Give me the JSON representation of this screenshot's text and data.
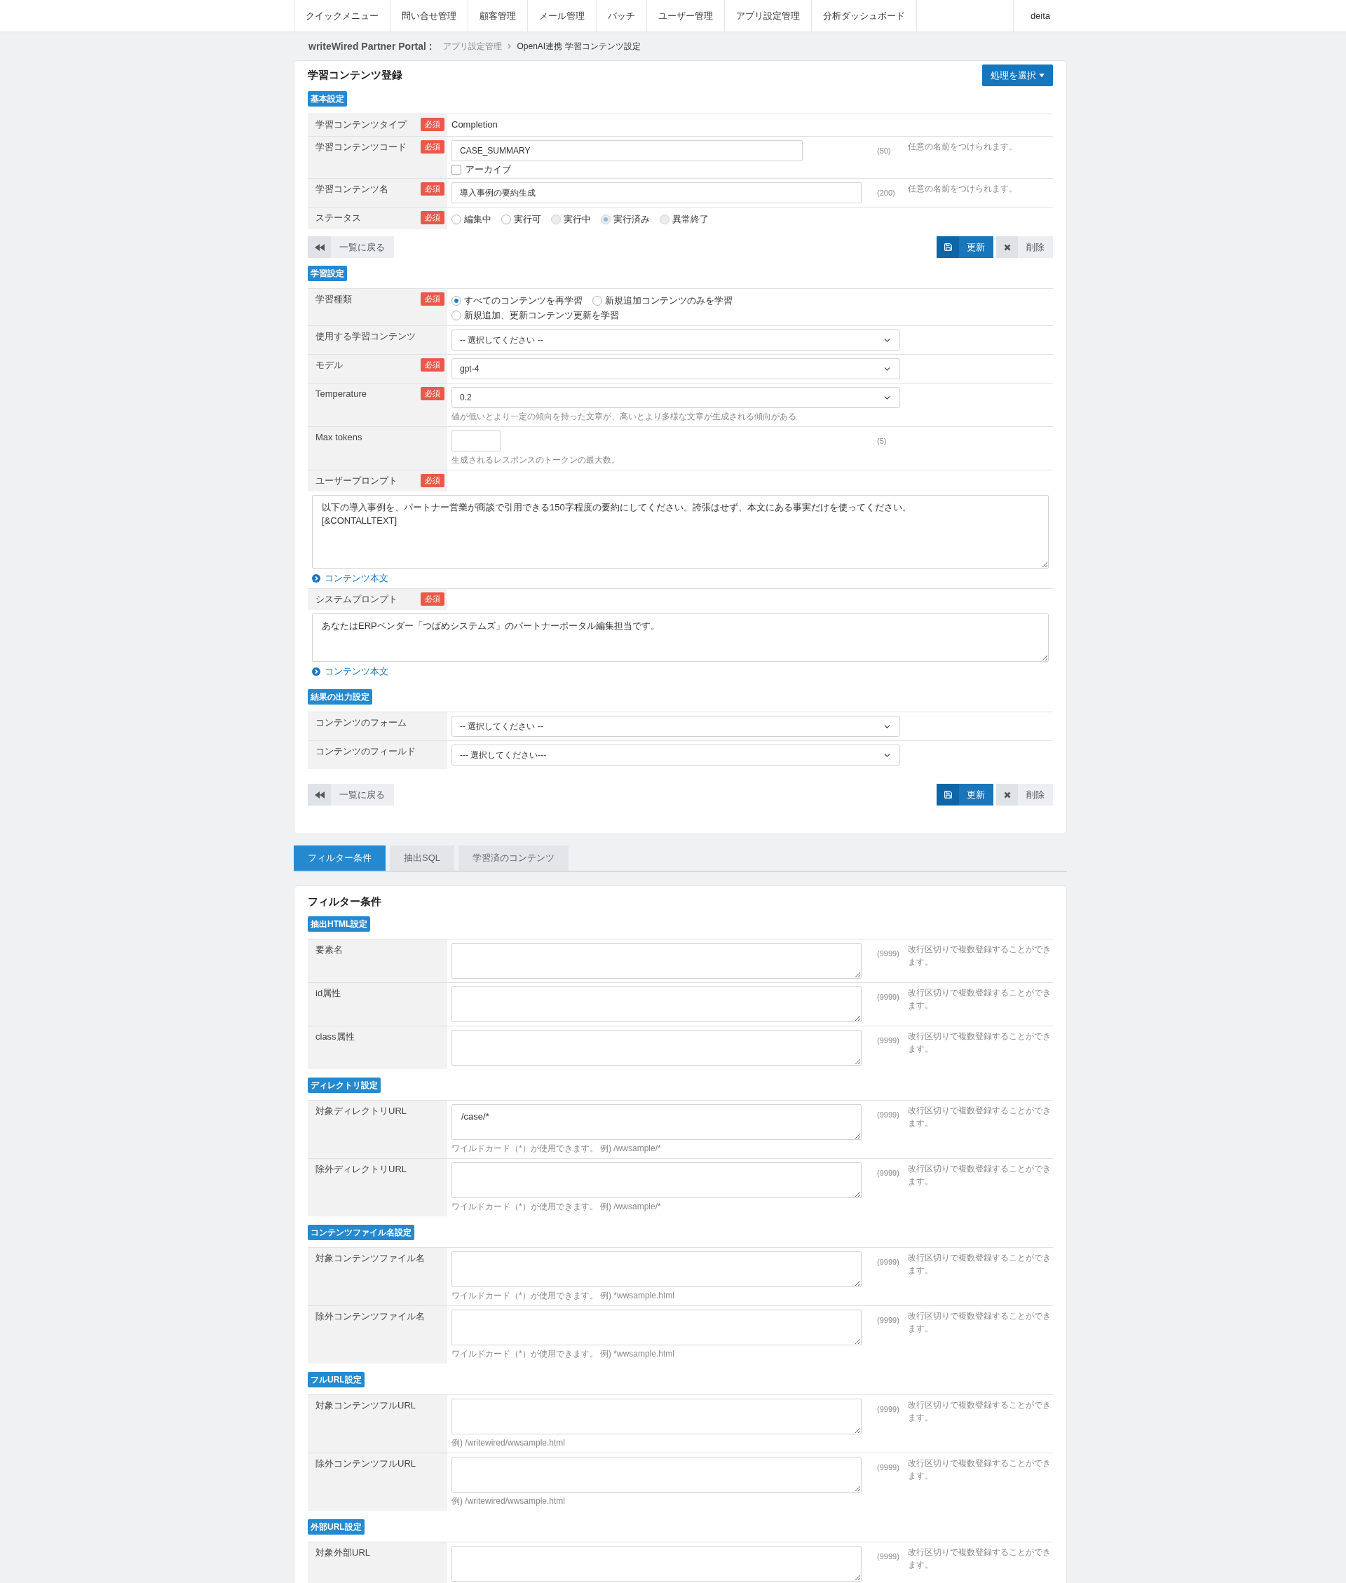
{
  "nav": {
    "items": [
      "クイックメニュー",
      "問い合せ管理",
      "顧客管理",
      "メール管理",
      "バッチ",
      "ユーザー管理",
      "アプリ設定管理",
      "分析ダッシュボード"
    ],
    "user": "deita"
  },
  "breadcrumb": {
    "portal": "writeWired Partner Portal :",
    "items": [
      "アプリ設定管理",
      "OpenAI連携 学習コンテンツ設定"
    ]
  },
  "main_card": {
    "title": "学習コンテンツ登録",
    "action_button": "処理を選択",
    "blocks": [
      {
        "kind": "section",
        "badge": "基本設定",
        "rows": [
          {
            "kind": "static",
            "label": "学習コンテンツタイプ",
            "required": "必須",
            "value": "Completion"
          },
          {
            "kind": "code",
            "label": "学習コンテンツコード",
            "required": "必須",
            "value": "CASE_SUMMARY",
            "count": "(50)",
            "help": "任意の名前をつけられます。",
            "checkbox": {
              "label": "アーカイブ",
              "checked": false
            }
          },
          {
            "kind": "text",
            "label": "学習コンテンツ名",
            "required": "必須",
            "value": "導入事例の要約生成",
            "count": "(200)",
            "help": "任意の名前をつけられます。"
          },
          {
            "kind": "radio",
            "label": "ステータス",
            "required": "必須",
            "options": [
              {
                "label": "編集中",
                "selected": false,
                "disabled": false
              },
              {
                "label": "実行可",
                "selected": false,
                "disabled": false
              },
              {
                "label": "実行中",
                "selected": false,
                "disabled": true
              },
              {
                "label": "実行済み",
                "selected": true,
                "disabled": true
              },
              {
                "label": "異常終了",
                "selected": false,
                "disabled": true
              }
            ]
          }
        ]
      },
      {
        "kind": "buttons",
        "back": "一覧に戻る",
        "update": "更新",
        "delete": "削除"
      },
      {
        "kind": "section",
        "badge": "学習設定",
        "rows": [
          {
            "kind": "radio",
            "label": "学習種類",
            "required": "必須",
            "options": [
              {
                "label": "すべてのコンテンツを再学習",
                "selected": true,
                "disabled": false
              },
              {
                "label": "新規追加コンテンツのみを学習",
                "selected": false,
                "disabled": false
              },
              {
                "label": "新規追加、更新コンテンツ更新を学習",
                "selected": false,
                "disabled": false
              }
            ]
          },
          {
            "kind": "select",
            "label": "使用する学習コンテンツ",
            "value": "-- 選択してください --"
          },
          {
            "kind": "select",
            "label": "モデル",
            "required": "必須",
            "value": "gpt-4"
          },
          {
            "kind": "select",
            "label": "Temperature",
            "required": "必須",
            "value": "0.2",
            "note": "値が低いとより一定の傾向を持った文章が、高いとより多様な文章が生成される傾向がある"
          },
          {
            "kind": "number",
            "label": "Max tokens",
            "count": "(5)",
            "note": "生成されるレスポンスのトークンの最大数。"
          },
          {
            "kind": "prompt",
            "label": "ユーザープロンプト",
            "required": "必須",
            "value": "以下の導入事例を、パートナー営業が商談で引用できる150字程度の要約にしてください。誇張はせず、本文にある事実だけを使ってください。\n[&CONTALLTEXT]",
            "link": "コンテンツ本文"
          },
          {
            "kind": "prompt",
            "label": "システムプロンプト",
            "required": "必須",
            "value": "あなたはERPベンダー「つばめシステムズ」のパートナーポータル編集担当です。",
            "link": "コンテンツ本文"
          }
        ]
      },
      {
        "kind": "section",
        "badge": "結果の出力設定",
        "rows": [
          {
            "kind": "select",
            "label": "コンテンツのフォーム",
            "value": "-- 選択してください --"
          },
          {
            "kind": "select",
            "label": "コンテンツのフィールド",
            "value": "--- 選択してください---"
          }
        ]
      },
      {
        "kind": "buttons",
        "back": "一覧に戻る",
        "update": "更新",
        "delete": "削除"
      }
    ]
  },
  "tabs": [
    {
      "label": "フィルター条件",
      "selected": true
    },
    {
      "label": "抽出SQL",
      "selected": false
    },
    {
      "label": "学習済のコンテンツ",
      "selected": false
    }
  ],
  "filter_card": {
    "title": "フィルター条件",
    "sections": [
      {
        "badge": "抽出HTML設定",
        "rows": [
          {
            "kind": "textarea",
            "label": "要素名",
            "count": "(9999)",
            "help": "改行区切りで複数登録することができます。"
          },
          {
            "kind": "textarea",
            "label": "id属性",
            "count": "(9999)",
            "help": "改行区切りで複数登録することができます。"
          },
          {
            "kind": "textarea",
            "label": "class属性",
            "count": "(9999)",
            "help": "改行区切りで複数登録することができます。"
          }
        ]
      },
      {
        "badge": "ディレクトリ設定",
        "rows": [
          {
            "kind": "textarea",
            "label": "対象ディレクトリURL",
            "value": "/case/*",
            "count": "(9999)",
            "help": "改行区切りで複数登録することができます。",
            "note": "ワイルドカード（*）が使用できます。 例) /wwsample/*"
          },
          {
            "kind": "textarea",
            "label": "除外ディレクトリURL",
            "count": "(9999)",
            "help": "改行区切りで複数登録することができます。",
            "note": "ワイルドカード（*）が使用できます。 例) /wwsample/*"
          }
        ]
      },
      {
        "badge": "コンテンツファイル名設定",
        "rows": [
          {
            "kind": "textarea",
            "label": "対象コンテンツファイル名",
            "count": "(9999)",
            "help": "改行区切りで複数登録することができます。",
            "note": "ワイルドカード（*）が使用できます。 例) *wwsample.html"
          },
          {
            "kind": "textarea",
            "label": "除外コンテンツファイル名",
            "count": "(9999)",
            "help": "改行区切りで複数登録することができます。",
            "note": "ワイルドカード（*）が使用できます。 例) *wwsample.html"
          }
        ]
      },
      {
        "badge": "フルURL設定",
        "rows": [
          {
            "kind": "textarea",
            "label": "対象コンテンツフルURL",
            "count": "(9999)",
            "help": "改行区切りで複数登録することができます。",
            "note": "例) /writewired/wwsample.html"
          },
          {
            "kind": "textarea",
            "label": "除外コンテンツフルURL",
            "count": "(9999)",
            "help": "改行区切りで複数登録することができます。",
            "note": "例) /writewired/wwsample.html"
          }
        ]
      },
      {
        "badge": "外部URL設定",
        "rows": [
          {
            "kind": "textarea",
            "label": "対象外部URL",
            "count": "(9999)",
            "help": "改行区切りで複数登録することができます。"
          }
        ]
      }
    ]
  }
}
